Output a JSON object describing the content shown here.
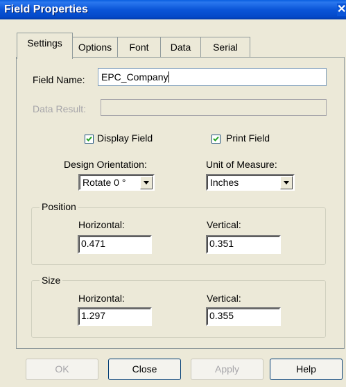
{
  "window": {
    "title": "Field Properties",
    "close_glyph": "✕"
  },
  "tabs": [
    {
      "label": "Settings",
      "active": true
    },
    {
      "label": "Options",
      "active": false
    },
    {
      "label": "Font",
      "active": false
    },
    {
      "label": "Data",
      "active": false
    },
    {
      "label": "Serial",
      "active": false
    }
  ],
  "settings": {
    "field_name_label": "Field Name:",
    "field_name_value": "EPC_Company",
    "data_result_label": "Data Result:",
    "data_result_value": "",
    "display_field_label": "Display Field",
    "display_field_checked": true,
    "print_field_label": "Print Field",
    "print_field_checked": true,
    "design_orientation_label": "Design Orientation:",
    "design_orientation_value": "Rotate 0 °",
    "unit_of_measure_label": "Unit of Measure:",
    "unit_of_measure_value": "Inches",
    "position": {
      "title": "Position",
      "horizontal_label": "Horizontal:",
      "horizontal_value": "0.471",
      "vertical_label": "Vertical:",
      "vertical_value": "0.351"
    },
    "size": {
      "title": "Size",
      "horizontal_label": "Horizontal:",
      "horizontal_value": "1.297",
      "vertical_label": "Vertical:",
      "vertical_value": "0.355"
    }
  },
  "buttons": {
    "ok": "OK",
    "close": "Close",
    "apply": "Apply",
    "help": "Help"
  },
  "colors": {
    "titlebar": "#0a55d8",
    "dialog_bg": "#ece9d8",
    "disabled_text": "#a7a6aa"
  }
}
